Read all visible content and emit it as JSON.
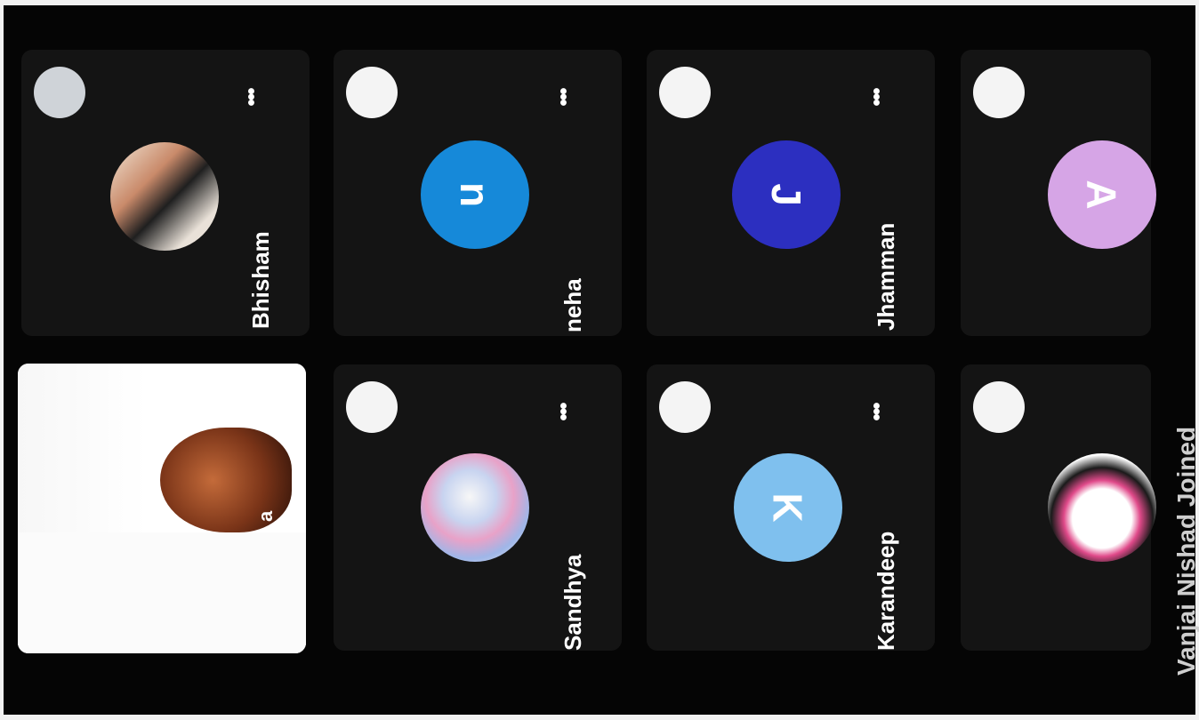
{
  "participants": [
    {
      "name": "Bhisham",
      "avatar_type": "photo",
      "avatar_icon": "user-photo"
    },
    {
      "name": "neha",
      "avatar_type": "initial",
      "initial": "n",
      "color": "#1689d9"
    },
    {
      "name": "Jhamman",
      "avatar_type": "initial",
      "initial": "J",
      "color": "#2c2fc0"
    },
    {
      "name": "",
      "avatar_type": "initial",
      "initial": "A",
      "color": "#d6a5e6"
    },
    {
      "name": "Sandhya",
      "avatar_type": "photo",
      "avatar_icon": "user-photo"
    },
    {
      "name": "Karandeep",
      "avatar_type": "initial",
      "initial": "K",
      "color": "#7fc0ee"
    },
    {
      "name": "",
      "avatar_type": "photo",
      "avatar_icon": "user-photo"
    }
  ],
  "self_view": {
    "name_fragment": "a"
  },
  "more_glyph": "•••",
  "notification": {
    "text": "Vanjai Nishad Joined"
  }
}
